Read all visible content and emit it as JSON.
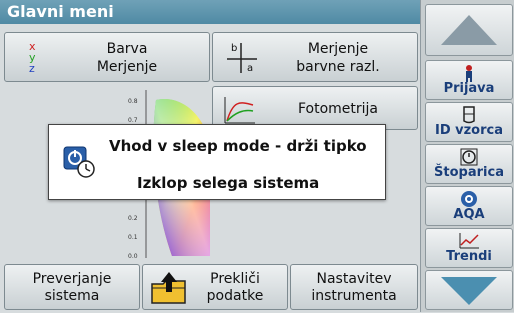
{
  "title": "Glavni meni",
  "tiles": {
    "color_measure": {
      "line1": "Barva",
      "line2": "Merjenje"
    },
    "color_diff": {
      "line1": "Merjenje",
      "line2": "barvne razl."
    },
    "photometry": {
      "label": "Fotometrija"
    },
    "chart_ticks": [
      "0.8",
      "0.7",
      "0.2",
      "0.1",
      "0.0"
    ]
  },
  "bottom": {
    "verify": {
      "line1": "Preverjanje",
      "line2": "sistema"
    },
    "recall": {
      "line1": "Prekliči",
      "line2": "podatke"
    },
    "settings": {
      "line1": "Nastavitev",
      "line2": "instrumenta"
    }
  },
  "sidebar": {
    "login": "Prijava",
    "sample_id": "ID vzorca",
    "timer": "Štoparica",
    "aqa": "AQA",
    "trends": "Trendi"
  },
  "dialog": {
    "line1": "Vhod v sleep mode - drži tipko",
    "line2": "Izklop selega sistema"
  },
  "colors": {
    "title_bar": "#5b93ab",
    "accent": "#1a3e7a"
  }
}
